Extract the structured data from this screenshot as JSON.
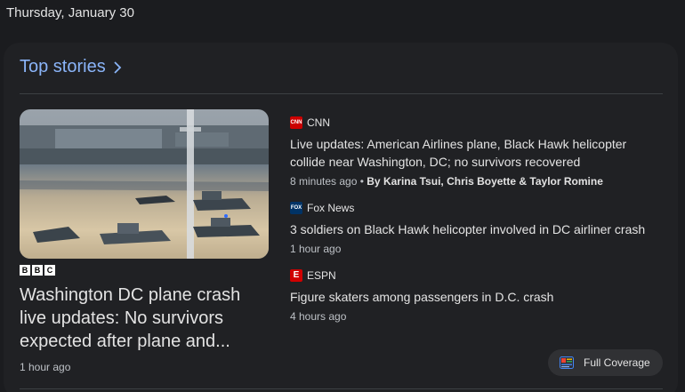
{
  "date_label": "Thursday, January 30",
  "section": {
    "title": "Top stories"
  },
  "lead_story": {
    "source": "BBC",
    "headline": "Washington DC plane crash live updates: No survivors expected after plane and...",
    "time": "1 hour ago"
  },
  "stories": [
    {
      "source": "CNN",
      "source_icon": "cnn-logo-icon",
      "source_color": "#cc0000",
      "title": "Live updates: American Airlines plane, Black Hawk helicopter collide near Washington, DC; no survivors recovered",
      "time": "8 minutes ago",
      "separator": " • ",
      "authors": "By Karina Tsui, Chris Boyette & Taylor Romine"
    },
    {
      "source": "Fox News",
      "source_icon": "fox-news-logo-icon",
      "source_color": "#003366",
      "title": "3 soldiers on Black Hawk helicopter involved in DC airliner crash",
      "time": "1 hour ago"
    },
    {
      "source": "ESPN",
      "source_icon": "espn-logo-icon",
      "source_color": "#d00000",
      "title": "Figure skaters among passengers in D.C. crash",
      "time": "4 hours ago"
    }
  ],
  "full_coverage": {
    "label": "Full Coverage"
  },
  "colors": {
    "accent_link": "#8ab4f8",
    "background": "#1b1c1f",
    "card": "#202124"
  }
}
